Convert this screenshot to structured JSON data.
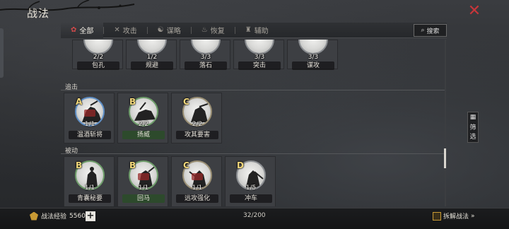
{
  "window": {
    "title": "战法",
    "close_icon": "close-x-icon"
  },
  "colors": {
    "accent_red": "#c8353a",
    "gold": "#f2d77a",
    "bg": "#2b2d30"
  },
  "tabs": [
    {
      "label": "全部",
      "icon": "all-icon",
      "active": true
    },
    {
      "label": "攻击",
      "icon": "crossed-swords-icon",
      "active": false
    },
    {
      "label": "谋略",
      "icon": "scheme-icon",
      "active": false
    },
    {
      "label": "恢复",
      "icon": "recover-icon",
      "active": false
    },
    {
      "label": "辅助",
      "icon": "support-icon",
      "active": false
    }
  ],
  "search": {
    "label": "搜索",
    "icon": "search-icon"
  },
  "sections": [
    {
      "label": "追击"
    },
    {
      "label": "被动"
    }
  ],
  "top_cards": [
    {
      "level": "2/2",
      "name": "包孔"
    },
    {
      "level": "1/2",
      "name": "规避"
    },
    {
      "level": "3/3",
      "name": "落石"
    },
    {
      "level": "3/3",
      "name": "突击"
    },
    {
      "level": "3/3",
      "name": "谋攻"
    }
  ],
  "pursuit_cards": [
    {
      "grade": "A",
      "level": "1/1",
      "name": "温酒斩将"
    },
    {
      "grade": "B",
      "level": "2/2",
      "name": "扬威"
    },
    {
      "grade": "C",
      "level": "2/2",
      "name": "攻其要害"
    }
  ],
  "passive_cards": [
    {
      "grade": "B",
      "level": "1/1",
      "name": "青囊秘要"
    },
    {
      "grade": "B",
      "level": "1/1",
      "name": "回马"
    },
    {
      "grade": "C",
      "level": "1/1",
      "name": "远攻强化"
    },
    {
      "grade": "D",
      "level": "1/5",
      "name": "冲车"
    }
  ],
  "filter": {
    "label": "筛选",
    "icon": "filter-grid-icon"
  },
  "footer": {
    "exp_label": "战法经验",
    "exp_value": "5560",
    "plus": "+",
    "count": "32/200",
    "split_label": "拆解战法",
    "split_arrow": "»"
  }
}
